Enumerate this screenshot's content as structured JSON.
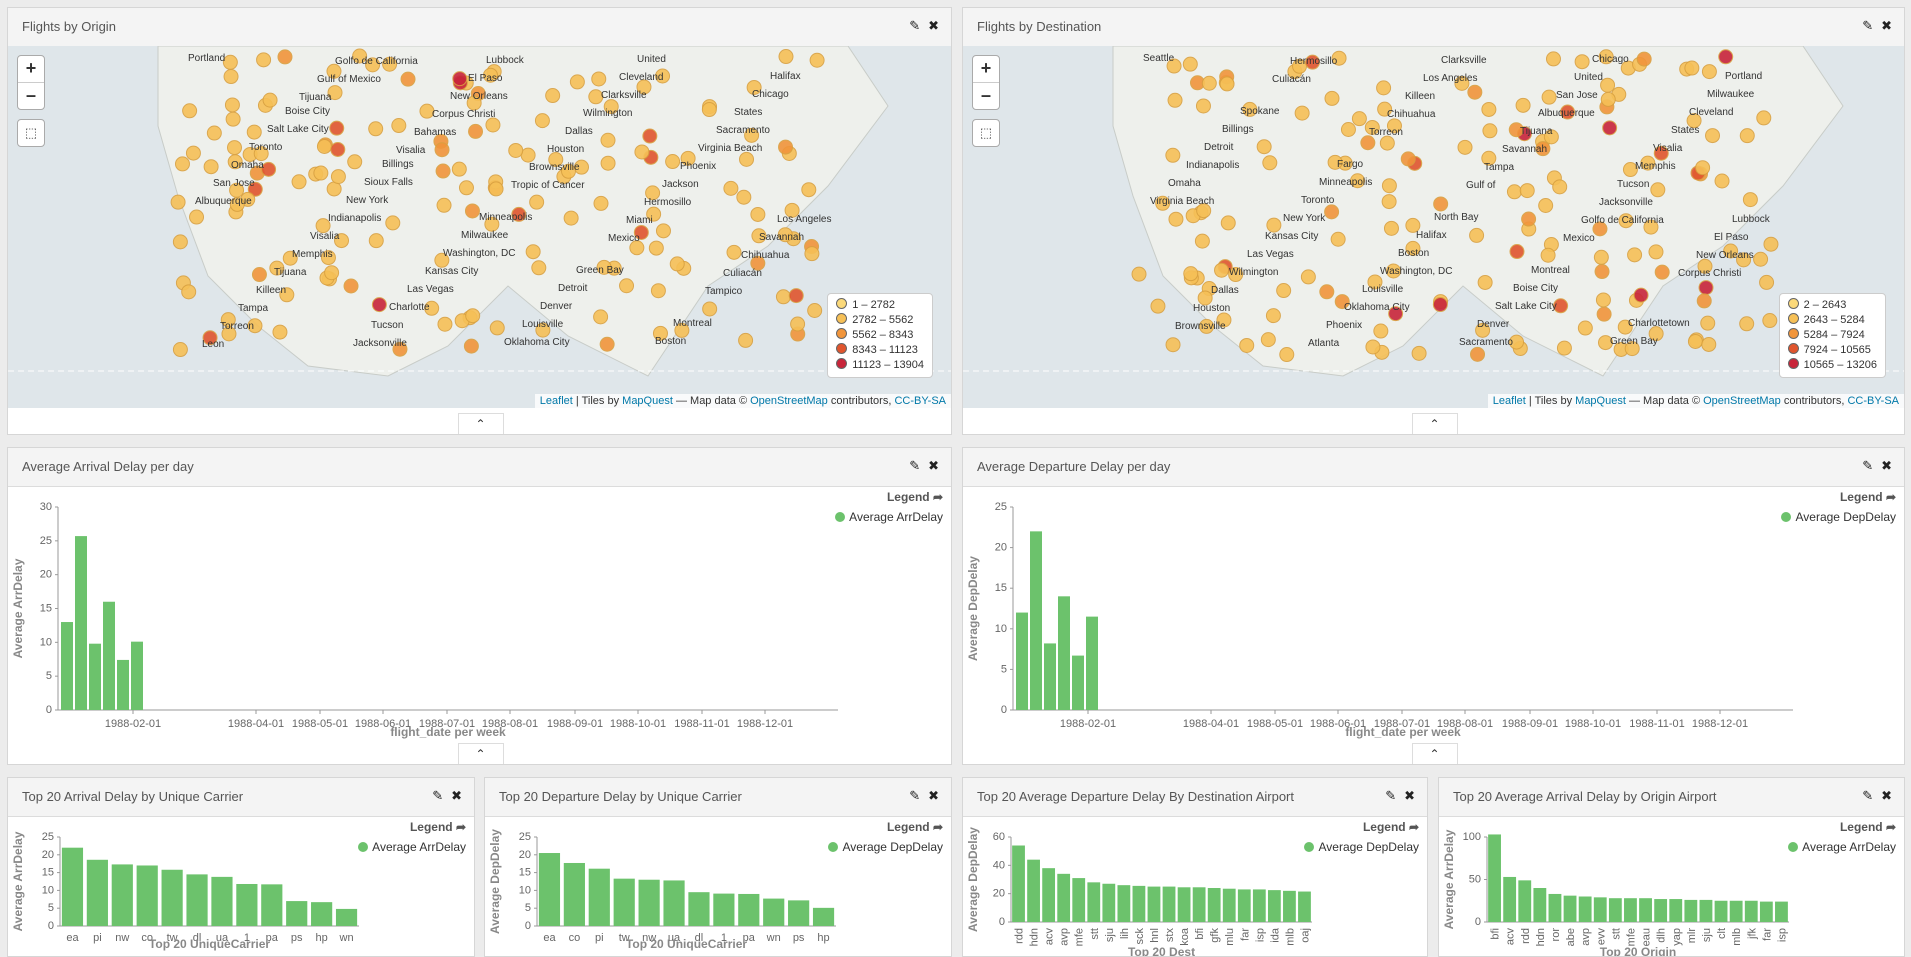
{
  "colors": {
    "bar": "#6cc26c",
    "bubble1": "#fbd97a",
    "bubble2": "#f6c057",
    "bubble3": "#f1953b",
    "bubble4": "#e0552e",
    "bubble5": "#c8253a"
  },
  "maps": [
    {
      "title": "Flights by Origin",
      "legend": [
        "1 – 2782",
        "2782 – 5562",
        "5562 – 8343",
        "8343 – 11123",
        "11123 – 13904"
      ],
      "labels": [
        "Portland",
        "Boise City",
        "Billings",
        "Minneapolis",
        "Green Bay",
        "Montreal",
        "Halifax",
        "Salt Lake City",
        "Sioux Falls",
        "Milwaukee",
        "Detroit",
        "Boston",
        "Chicago",
        "Toronto",
        "New York",
        "Washington, DC",
        "Denver",
        "United",
        "States",
        "Omaha",
        "Indianapolis",
        "Kansas City",
        "Louisville",
        "Cleveland",
        "Sacramento",
        "San Jose",
        "Visalia",
        "Las Vegas",
        "Oklahoma City",
        "Clarksville",
        "Virginia Beach",
        "Albuquerque",
        "Memphis",
        "Charlotte",
        "Lubbock",
        "Wilmington",
        "Phoenix",
        "Los Angeles",
        "Tijuana",
        "Tucson",
        "El Paso",
        "Dallas",
        "Jackson",
        "Savannah",
        "Killeen",
        "Jacksonville",
        "New Orleans",
        "Houston",
        "Hermosillo",
        "Chihuahua",
        "Tampa",
        "Golfo de California",
        "Corpus Christi",
        "Brownsville",
        "Miami",
        "Culiacán",
        "Torreon",
        "Gulf of Mexico",
        "Bahamas",
        "Tropic of Cancer",
        "Mexico",
        "Tampico",
        "Leon",
        "Tijuana",
        "Visalia"
      ],
      "attribution": {
        "leaflet": "Leaflet",
        "tiles_by": "| Tiles by",
        "mapquest": "MapQuest",
        "map_data": "— Map data ©",
        "osm": "OpenStreetMap",
        "contributors": "contributors,",
        "license": "CC-BY-SA"
      }
    },
    {
      "title": "Flights by Destination",
      "legend": [
        "2 – 2643",
        "2643 – 5284",
        "5284 – 7924",
        "7924 – 10565",
        "10565 – 13206"
      ],
      "labels": [
        "Seattle",
        "Spokane",
        "Fargo",
        "North Bay",
        "Montreal",
        "Charlottetown",
        "Portland",
        "Billings",
        "Minneapolis",
        "Halifax",
        "Boise City",
        "Green Bay",
        "Milwaukee",
        "Detroit",
        "Toronto",
        "Boston",
        "Salt Lake City",
        "Chicago",
        "Cleveland",
        "Indianapolis",
        "New York",
        "Washington, DC",
        "Denver",
        "United",
        "States",
        "Omaha",
        "Kansas City",
        "Louisville",
        "Sacramento",
        "San Jose",
        "Visalia",
        "Virginia Beach",
        "Las Vegas",
        "Oklahoma City",
        "Clarksville",
        "Albuquerque",
        "Memphis",
        "Lubbock",
        "Wilmington",
        "Phoenix",
        "Los Angeles",
        "Tijuana",
        "Tucson",
        "El Paso",
        "Dallas",
        "Atlanta",
        "Killeen",
        "Savannah",
        "Jacksonville",
        "New Orleans",
        "Houston",
        "Hermosillo",
        "Chihuahua",
        "Tampa",
        "Golfo de California",
        "Corpus Christi",
        "Brownsville",
        "Culiacán",
        "Torreon",
        "Gulf of",
        "Mexico"
      ],
      "attribution": {
        "leaflet": "Leaflet",
        "tiles_by": "| Tiles by",
        "mapquest": "MapQuest",
        "map_data": "— Map data ©",
        "osm": "OpenStreetMap",
        "contributors": "contributors,",
        "license": "CC-BY-SA"
      }
    }
  ],
  "legend_title": "Legend",
  "chart_data": [
    {
      "type": "bar",
      "title": "Average Arrival Delay per day",
      "ylabel": "Average ArrDelay",
      "xlabel": "flight_date per week",
      "series_name": "Average ArrDelay",
      "ylim": [
        0,
        30
      ],
      "yticks": [
        0,
        5,
        10,
        15,
        20,
        25,
        30
      ],
      "x_ticks": [
        "1988-02-01",
        "1988-04-01",
        "1988-05-01",
        "1988-06-01",
        "1988-07-01",
        "1988-08-01",
        "1988-09-01",
        "1988-10-01",
        "1988-11-01",
        "1988-12-01"
      ],
      "values": [
        13,
        25.7,
        9.8,
        16,
        7.4,
        10.1
      ]
    },
    {
      "type": "bar",
      "title": "Average Departure Delay per day",
      "ylabel": "Average DepDelay",
      "xlabel": "flight_date per week",
      "series_name": "Average DepDelay",
      "ylim": [
        0,
        25
      ],
      "yticks": [
        0,
        5,
        10,
        15,
        20,
        25
      ],
      "x_ticks": [
        "1988-02-01",
        "1988-04-01",
        "1988-05-01",
        "1988-06-01",
        "1988-07-01",
        "1988-08-01",
        "1988-09-01",
        "1988-10-01",
        "1988-11-01",
        "1988-12-01"
      ],
      "values": [
        12,
        22,
        8.2,
        14,
        6.7,
        11.5
      ]
    },
    {
      "type": "bar",
      "title": "Top 20 Arrival Delay by Unique Carrier",
      "ylabel": "Average ArrDelay",
      "xlabel": "Top 20 UniqueCarrier",
      "series_name": "Average ArrDelay",
      "ylim": [
        0,
        25
      ],
      "yticks": [
        0,
        5,
        10,
        15,
        20,
        25
      ],
      "categories": [
        "ea",
        "pi",
        "nw",
        "co",
        "tw",
        "dl",
        "ua",
        "1",
        "pa",
        "ps",
        "hp",
        "wn"
      ],
      "values": [
        22,
        18.6,
        17.3,
        17,
        15.8,
        14.5,
        13.8,
        11.8,
        11.7,
        7,
        6.7,
        4.8
      ]
    },
    {
      "type": "bar",
      "title": "Top 20 Departure Delay by Unique Carrier",
      "ylabel": "Average DepDelay",
      "xlabel": "Top 20 UniqueCarrier",
      "series_name": "Average DepDelay",
      "ylim": [
        0,
        25
      ],
      "yticks": [
        0,
        5,
        10,
        15,
        20,
        25
      ],
      "categories": [
        "ea",
        "co",
        "pi",
        "tw",
        "nw",
        "ua",
        "dl",
        "1",
        "pa",
        "wn",
        "ps",
        "hp"
      ],
      "values": [
        20.5,
        17.7,
        16.1,
        13.3,
        13,
        12.8,
        9.5,
        9.1,
        9,
        7.7,
        7.2,
        5.1
      ]
    },
    {
      "type": "bar",
      "title": "Top 20 Average Departure Delay By Destination Airport",
      "ylabel": "Average DepDelay",
      "xlabel": "Top 20 Dest",
      "series_name": "Average DepDelay",
      "ylim": [
        0,
        60
      ],
      "yticks": [
        0,
        20,
        40,
        60
      ],
      "categories": [
        "rdd",
        "hdn",
        "acv",
        "avp",
        "mfe",
        "stt",
        "sju",
        "lih",
        "sck",
        "hnl",
        "stx",
        "koa",
        "bfi",
        "gfk",
        "mlu",
        "far",
        "isp",
        "ida",
        "mlb",
        "oaj"
      ],
      "values": [
        54,
        44,
        38,
        34,
        31,
        28,
        27,
        26,
        25.5,
        25,
        25,
        24.5,
        24.5,
        24,
        23.5,
        23,
        23,
        22.5,
        22,
        21.5
      ]
    },
    {
      "type": "bar",
      "title": "Top 20 Average Arrival Delay by Origin Airport",
      "ylabel": "Average ArrDelay",
      "xlabel": "Top 20 Origin",
      "series_name": "Average ArrDelay",
      "ylim": [
        0,
        100
      ],
      "yticks": [
        0,
        50,
        100
      ],
      "categories": [
        "bfi",
        "acv",
        "rdd",
        "hdn",
        "ror",
        "abe",
        "avp",
        "evv",
        "stt",
        "mfe",
        "eau",
        "dlh",
        "yap",
        "mlr",
        "sju",
        "clt",
        "mlb",
        "jfk",
        "far",
        "isp"
      ],
      "values": [
        103,
        53,
        49,
        40,
        33,
        31,
        30,
        29,
        28,
        28,
        28,
        27,
        27,
        26,
        26,
        25,
        25,
        25,
        24,
        24
      ]
    }
  ]
}
